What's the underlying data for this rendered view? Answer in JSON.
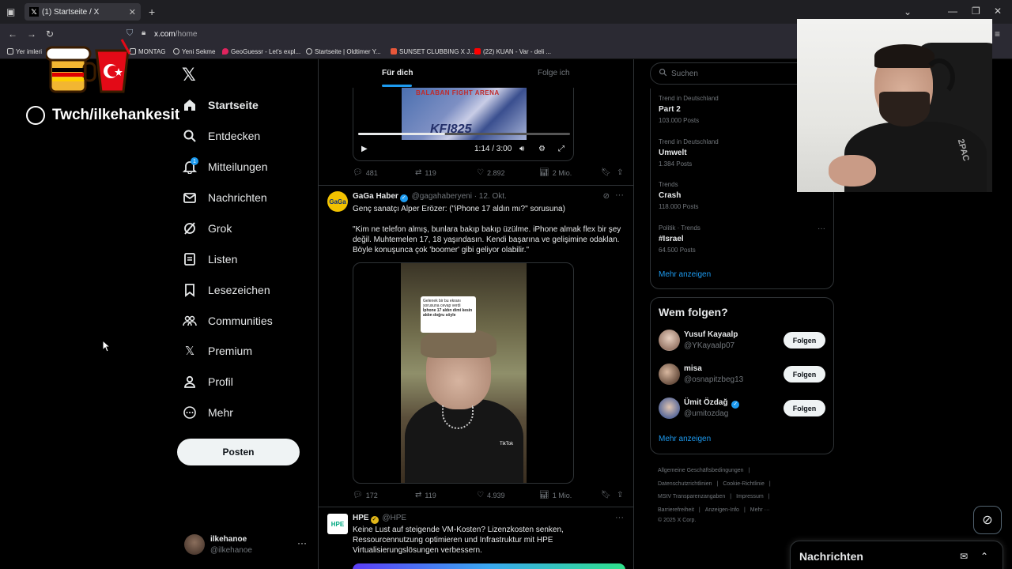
{
  "browser": {
    "tab_title": "(1) Startseite / X",
    "url_host": "x.com",
    "url_path": "/home",
    "bookmarks": [
      "Yer imleri",
      "MONTAG",
      "Yeni Sekme",
      "GeoGuessr - Let's expl...",
      "Startseite | Oldtimer Y...",
      "SUNSET CLUBBING X J...",
      "(22) KUAN - Var - deli ..."
    ]
  },
  "overlay": {
    "channel_text": "Twch/ilkehankesit"
  },
  "nav": {
    "items": [
      {
        "label": "Startseite",
        "icon": "home-icon"
      },
      {
        "label": "Entdecken",
        "icon": "search-icon"
      },
      {
        "label": "Mitteilungen",
        "icon": "bell-icon"
      },
      {
        "label": "Nachrichten",
        "icon": "mail-icon"
      },
      {
        "label": "Grok",
        "icon": "grok-icon"
      },
      {
        "label": "Listen",
        "icon": "list-icon"
      },
      {
        "label": "Lesezeichen",
        "icon": "bookmark-icon"
      },
      {
        "label": "Communities",
        "icon": "communities-icon"
      },
      {
        "label": "Premium",
        "icon": "x-icon"
      },
      {
        "label": "Profil",
        "icon": "profile-icon"
      },
      {
        "label": "Mehr",
        "icon": "more-icon"
      }
    ],
    "notification_badge": "1",
    "post_button": "Posten",
    "account": {
      "name": "ilkehanoe",
      "handle": "@ilkehanoe"
    }
  },
  "main": {
    "tabs": {
      "for_you": "Für dich",
      "following": "Folge ich"
    },
    "video1": {
      "time": "1:14 / 3:00",
      "progress": 0.41,
      "frame_text_top": "BALABAN FIGHT ARENA",
      "frame_text_bottom": "KFI825"
    },
    "tweet1_actions": {
      "replies": "481",
      "retweets": "119",
      "likes": "2.892",
      "views": "2 Mio."
    },
    "tweet2": {
      "avatar_text": "GaGa",
      "name": "GaGa Haber",
      "handle": "@gagahaberyeni",
      "date": "· 12. Okt.",
      "line1": "Genç sanatçı Alper Erözer: (\"iPhone 17 aldın mı?\" sorusuna)",
      "quote": "\"Kim ne telefon almış, bunlara bakıp bakıp üzülme. iPhone almak flex bir şey değil. Muhtemelen 17, 18 yaşındasın. Kendi başarına ve gelişimine odaklan. Böyle konuşunca çok 'boomer' gibi geliyor olabilir.\"",
      "video_overlay_small": "Gelenek bir bu ekranı sorusuna cevap verdi",
      "video_overlay_bold": "İphone 17 aldın dimi kesin aldın doğru söyle",
      "video_watermark": "TikTok"
    },
    "tweet2_actions": {
      "replies": "172",
      "retweets": "119",
      "likes": "4.939",
      "views": "1 Mio."
    },
    "tweet3": {
      "avatar_text": "HPE",
      "name": "HPE",
      "handle": "@HPE",
      "text": "Keine Lust auf steigende VM-Kosten? Lizenzkosten senken, Ressourcennutzung optimieren und Infrastruktur mit HPE Virtualisierungslösungen verbessern."
    }
  },
  "right": {
    "search_placeholder": "Suchen",
    "trends": [
      {
        "category": "Trend in Deutschland",
        "title": "Part 2",
        "count": "103.000 Posts"
      },
      {
        "category": "Trend in Deutschland",
        "title": "Umwelt",
        "count": "1.384 Posts"
      },
      {
        "category": "Trends",
        "title": "Crash",
        "count": "118.000 Posts"
      },
      {
        "category": "Politik · Trends",
        "title": "#Israel",
        "count": "64.500 Posts"
      }
    ],
    "trends_more": "Mehr anzeigen",
    "who_to_follow": {
      "title": "Wem folgen?",
      "users": [
        {
          "name": "Yusuf Kayaalp",
          "handle": "@YKayaalp07",
          "verified": false
        },
        {
          "name": "misa",
          "handle": "@osnapitzbeg13",
          "verified": false
        },
        {
          "name": "Ümit Özdağ",
          "handle": "@umitozdag",
          "verified": true
        }
      ],
      "follow_label": "Folgen",
      "more": "Mehr anzeigen"
    },
    "footer": [
      "Allgemeine Geschäftsbedingungen",
      "|",
      "Datenschutzrichtlinien",
      "|",
      "Cookie-Richtlinie",
      "|",
      "MStV Transparenzangaben",
      "|",
      "Impressum",
      "|",
      "Barrierefreiheit",
      "|",
      "Anzeigen-Info",
      "|",
      "Mehr ···",
      "© 2025 X Corp."
    ]
  },
  "webcam": {
    "shirt_text": "2PAC"
  },
  "messages_drawer": {
    "title": "Nachrichten"
  },
  "colors": {
    "accent": "#1d9bf0",
    "background": "#000000",
    "border": "#2f3336",
    "muted": "#71767b"
  }
}
